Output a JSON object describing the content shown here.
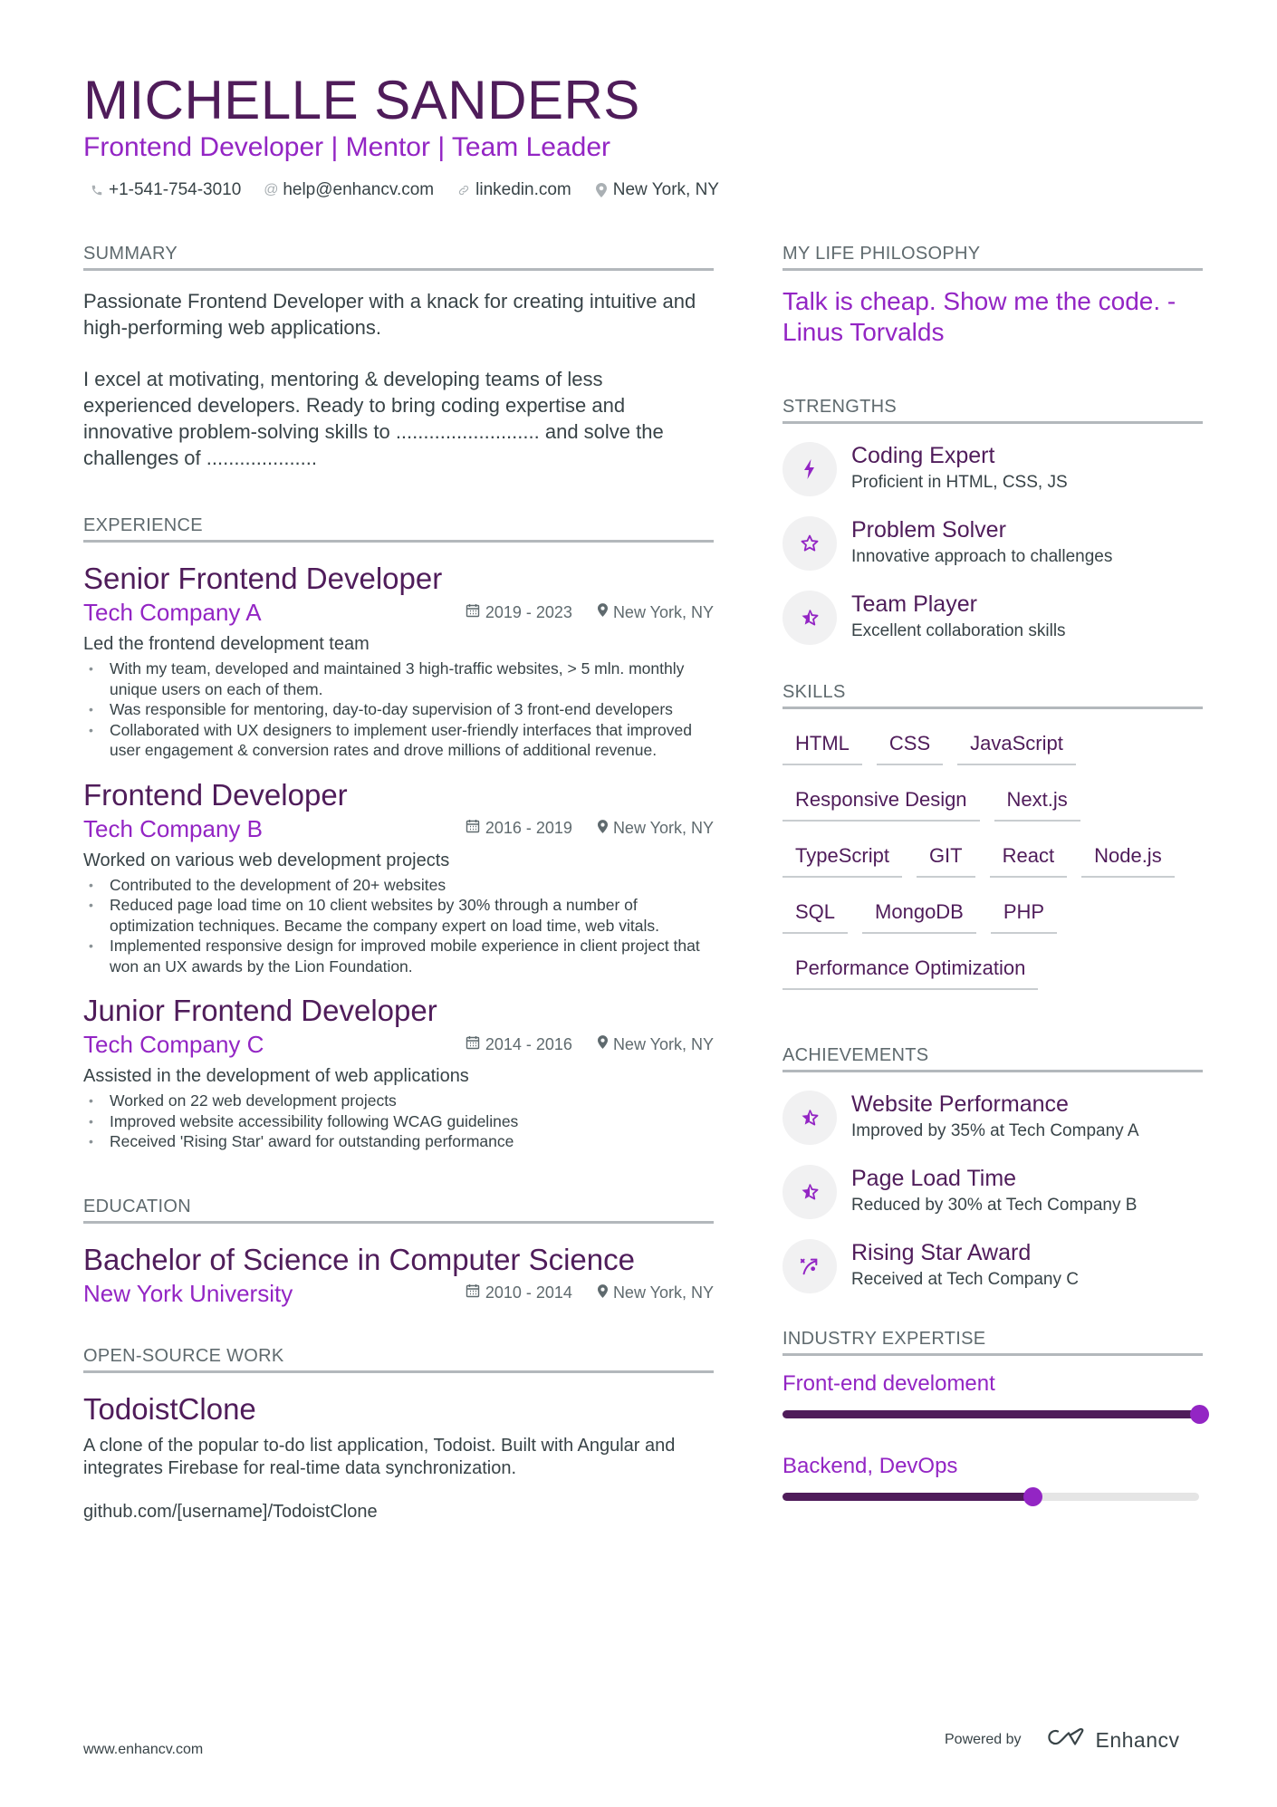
{
  "header": {
    "name": "MICHELLE SANDERS",
    "subtitle": "Frontend Developer | Mentor | Team Leader",
    "contacts": [
      {
        "icon": "phone-icon",
        "text": "+1-541-754-3010"
      },
      {
        "icon": "at-icon",
        "text": "help@enhancv.com"
      },
      {
        "icon": "link-icon",
        "text": "linkedin.com"
      },
      {
        "icon": "location-pin-icon",
        "text": "New York, NY"
      }
    ]
  },
  "summary": {
    "title": "SUMMARY",
    "paragraphs": [
      "Passionate Frontend Developer with a knack for creating intuitive and high-performing web applications.",
      "I excel at motivating, mentoring & developing teams of less experienced developers. Ready to bring coding expertise and innovative problem-solving skills to .......................... and solve the challenges of ...................."
    ]
  },
  "experience": {
    "title": "EXPERIENCE",
    "jobs": [
      {
        "title": "Senior Frontend Developer",
        "company": "Tech Company A",
        "dates": "2019 - 2023",
        "location": "New York, NY",
        "description": "Led the frontend development team",
        "bullets": [
          "With my team, developed and maintained 3 high-traffic websites, > 5 mln. monthly unique users on each of them.",
          "Was responsible for mentoring, day-to-day supervision of 3 front-end developers",
          "Collaborated with UX designers to implement user-friendly interfaces that improved user engagement & conversion rates and drove millions of additional revenue."
        ]
      },
      {
        "title": "Frontend Developer",
        "company": "Tech Company B",
        "dates": "2016 - 2019",
        "location": "New York, NY",
        "description": "Worked on various web development projects",
        "bullets": [
          "Contributed to the development of 20+ websites",
          "Reduced page load time on 10 client websites by 30% through a number of optimization techniques. Became the company expert on load time, web vitals.",
          "Implemented responsive design for improved mobile experience in client project that won an UX awards by the Lion Foundation."
        ]
      },
      {
        "title": "Junior Frontend Developer",
        "company": "Tech Company C",
        "dates": "2014 - 2016",
        "location": "New York, NY",
        "description": "Assisted in the development of web applications",
        "bullets": [
          "Worked on 22 web development projects",
          "Improved website accessibility following WCAG guidelines",
          "Received 'Rising Star' award for outstanding performance"
        ]
      }
    ]
  },
  "education": {
    "title": "EDUCATION",
    "degree": "Bachelor of Science in Computer Science",
    "school": "New York University",
    "dates": "2010 - 2014",
    "location": "New York, NY"
  },
  "open_source": {
    "title": "OPEN-SOURCE WORK",
    "project": "TodoistClone",
    "description": "A clone of the popular to-do list application, Todoist. Built with Angular and integrates Firebase for real-time data synchronization.",
    "link": "github.com/[username]/TodoistClone"
  },
  "philosophy": {
    "title": "MY LIFE PHILOSOPHY",
    "quote": "Talk is cheap. Show me the code. - Linus Torvalds"
  },
  "strengths": {
    "title": "STRENGTHS",
    "items": [
      {
        "icon": "lightning-bolt-icon",
        "title": "Coding Expert",
        "desc": "Proficient in HTML, CSS, JS"
      },
      {
        "icon": "star-outline-icon",
        "title": "Problem Solver",
        "desc": "Innovative approach to challenges"
      },
      {
        "icon": "star-half-icon",
        "title": "Team Player",
        "desc": "Excellent collaboration skills"
      }
    ]
  },
  "skills": {
    "title": "SKILLS",
    "tags": [
      "HTML",
      "CSS",
      "JavaScript",
      "Responsive Design",
      "Next.js",
      "TypeScript",
      "GIT",
      "React",
      "Node.js",
      "SQL",
      "MongoDB",
      "PHP",
      "Performance Optimization"
    ]
  },
  "achievements": {
    "title": "ACHIEVEMENTS",
    "items": [
      {
        "icon": "star-half-icon",
        "title": "Website Performance",
        "desc": "Improved by 35% at Tech Company A"
      },
      {
        "icon": "star-half-icon",
        "title": "Page Load Time",
        "desc": "Reduced by 30% at Tech Company B"
      },
      {
        "icon": "strategy-arrow-icon",
        "title": "Rising Star Award",
        "desc": "Received at Tech Company C"
      }
    ]
  },
  "industry_expertise": {
    "title": "INDUSTRY EXPERTISE",
    "items": [
      {
        "label": "Front-end develoment",
        "level_percent": 100
      },
      {
        "label": "Backend, DevOps",
        "level_percent": 60
      }
    ]
  },
  "footer": {
    "website": "www.enhancv.com",
    "powered_by": "Powered by",
    "brand": "Enhancv"
  },
  "colors": {
    "primary_dark": "#4f1c5a",
    "accent": "#9325c4",
    "text": "#384347",
    "muted": "#5f6a6e",
    "rule": "#b3b8bc"
  }
}
